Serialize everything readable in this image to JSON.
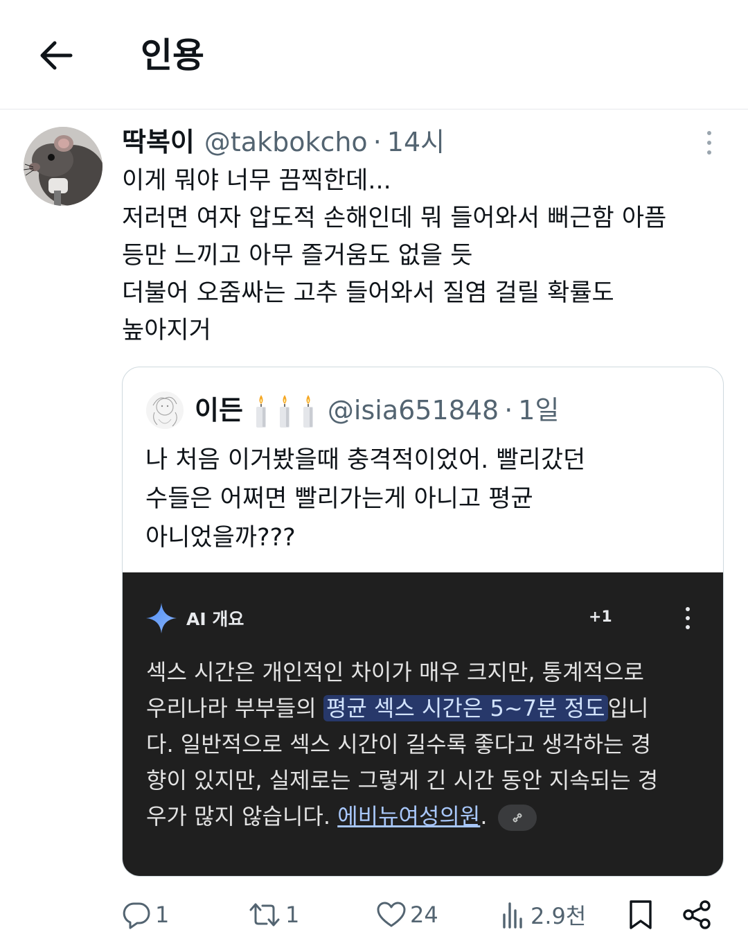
{
  "header": {
    "title": "인용"
  },
  "tweet": {
    "name": "딱복이",
    "handle": "@takbokcho",
    "separator": "·",
    "time": "14시",
    "lines": [
      "이게 뭐야 너무 끔찍한데...",
      "저러면 여자 압도적 손해인데 뭐 들어와서 뻐근함 아픔",
      "등만 느끼고 아무 즐거움도 없을 듯",
      "더불어 오줌싸는 고추 들어와서 질염 걸릴 확률도",
      "높아지거"
    ]
  },
  "quote": {
    "name": "이든",
    "handle": "@isia651848",
    "separator": "·",
    "time": "1일",
    "lines": [
      "나 처음 이거봤을때 충격적이었어. 빨리갔던",
      "수들은 어쩌면 빨리가는게 아니고 평균",
      "아니었을까???"
    ],
    "ai": {
      "title": "AI 개요",
      "plus": "+1",
      "line1": "섹스 시간은 개인적인 차이가 매우 크지만, 통계적으로",
      "line2_pre": "우리나라 부부들의 ",
      "line2_highlight": "평균 섹스 시간은 5~7분 정도",
      "line2_post": "입니",
      "line3": "다. 일반적으로 섹스 시간이 길수록 좋다고 생각하는 경",
      "line4": "향이 있지만, 실제로는 그렇게 긴 시간 동안 지속되는 경",
      "line5_pre": "우가 많지 않습니다. ",
      "line5_link": "에비뉴여성의원",
      "line5_post": "."
    }
  },
  "actions": {
    "reply_count": "1",
    "retweet_count": "1",
    "like_count": "24",
    "view_count": "2.9천"
  },
  "colors": {
    "text": "#0f1419",
    "muted": "#536471",
    "ai_background": "#1f1f1f",
    "highlight_background": "#27386a",
    "link": "#a8c7fa"
  },
  "icons": [
    "back-arrow-icon",
    "more-vertical-icon",
    "candle-icon",
    "sparkle-icon",
    "link-icon",
    "reply-icon",
    "retweet-icon",
    "heart-icon",
    "views-icon",
    "bookmark-icon",
    "share-icon"
  ]
}
